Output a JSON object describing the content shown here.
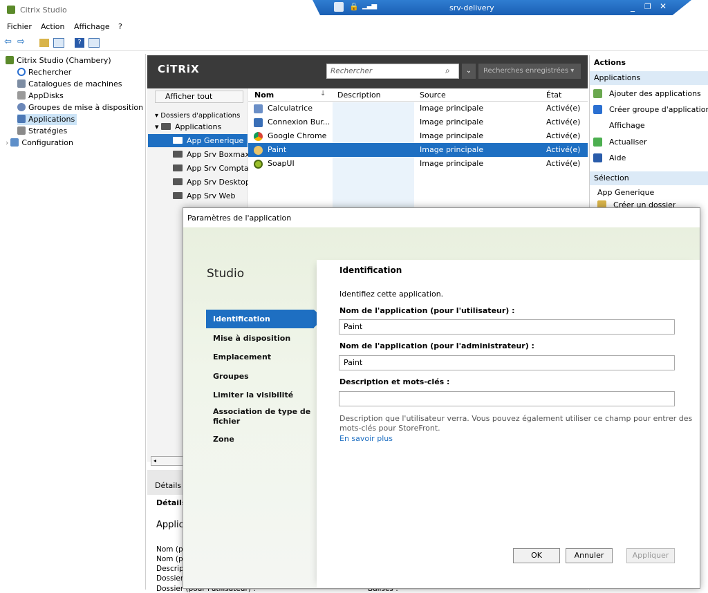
{
  "window": {
    "title": "Citrix Studio"
  },
  "remote": {
    "host": "srv-delivery"
  },
  "menu": [
    "Fichier",
    "Action",
    "Affichage",
    "?"
  ],
  "tree": {
    "root": "Citrix Studio (Chambery)",
    "items": [
      "Rechercher",
      "Catalogues de machines",
      "AppDisks",
      "Groupes de mise à disposition",
      "Applications",
      "Stratégies",
      "Configuration"
    ]
  },
  "header": {
    "logo": "CiTRiX",
    "search_placeholder": "Rechercher",
    "saved_searches": "Recherches enregistrées"
  },
  "folders": {
    "show_all": "Afficher tout",
    "section": "Dossiers d'applications",
    "root": "Applications",
    "items": [
      "App Generique",
      "App Srv Boxmax",
      "App Srv Comptab",
      "App Srv Desktop",
      "App Srv Web"
    ]
  },
  "grid": {
    "columns": [
      "Nom",
      "Description",
      "Source",
      "État"
    ],
    "rows": [
      {
        "name": "Calculatrice",
        "description": "",
        "source": "Image principale",
        "state": "Activé(e)"
      },
      {
        "name": "Connexion Bur...",
        "description": "",
        "source": "Image principale",
        "state": "Activé(e)"
      },
      {
        "name": "Google Chrome",
        "description": "",
        "source": "Image principale",
        "state": "Activé(e)"
      },
      {
        "name": "Paint",
        "description": "",
        "source": "Image principale",
        "state": "Activé(e)"
      },
      {
        "name": "SoapUI",
        "description": "",
        "source": "Image principale",
        "state": "Activé(e)"
      }
    ]
  },
  "actions": {
    "title": "Actions",
    "section": "Applications",
    "items": [
      "Ajouter des applications",
      "Créer groupe d'applications",
      "Affichage",
      "Actualiser",
      "Aide"
    ],
    "selection_title": "Sélection",
    "selection_name": "App Generique",
    "selection_item": "Créer un dossier"
  },
  "details": {
    "tab": "Détails",
    "tab_partial": "Détails -",
    "heading": "Applica",
    "labels": [
      "Nom (p",
      "Nom (p",
      "Descrip",
      "Dossier",
      "Dossier (pour l'utilisateur) :"
    ],
    "right_label": "Balises :"
  },
  "dialog": {
    "title": "Paramètres de l'application",
    "brand": "Studio",
    "nav": [
      "Identification",
      "Mise à disposition",
      "Emplacement",
      "Groupes",
      "Limiter la visibilité",
      "Association de type de",
      "fichier",
      "Zone"
    ],
    "section_title": "Identification",
    "intro": "Identifiez cette application.",
    "user_name_label": "Nom de l'application (pour l'utilisateur) :",
    "user_name_value": "Paint",
    "admin_name_label": "Nom de l'application (pour l'administrateur) :",
    "admin_name_value": "Paint",
    "desc_label": "Description et mots-clés :",
    "desc_value": "",
    "help_line1": "Description que l'utilisateur verra. Vous pouvez également utiliser ce champ pour entrer des",
    "help_line2": "mots-clés pour StoreFront.",
    "learn_more": "En savoir plus",
    "buttons": {
      "ok": "OK",
      "cancel": "Annuler",
      "apply": "Appliquer"
    }
  },
  "colors": {
    "accent": "#1e6fc2",
    "header_dark": "#3a3a3a",
    "remote_bar": "#1a5fb4"
  }
}
